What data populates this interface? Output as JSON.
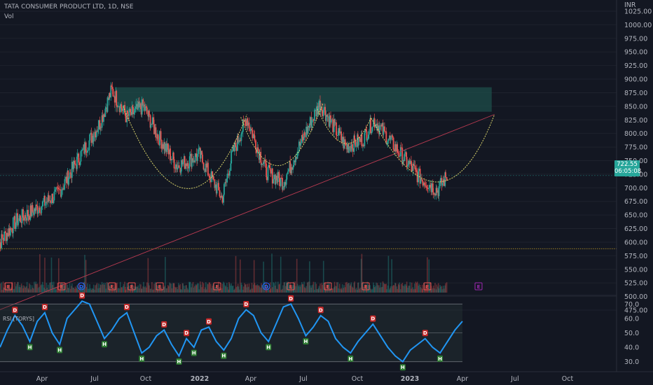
{
  "header": {
    "title": "TATA CONSUMER PRODUCT LTD, 1D, NSE",
    "volume_label": "Vol"
  },
  "price_axis": {
    "currency": "INR",
    "ticks": [
      "1025.00",
      "1000.00",
      "975.00",
      "950.00",
      "925.00",
      "900.00",
      "875.00",
      "850.00",
      "825.00",
      "800.00",
      "775.00",
      "750.00",
      "725.00",
      "700.00",
      "675.00",
      "650.00",
      "625.00",
      "600.00",
      "575.00",
      "550.00",
      "525.00",
      "500.00",
      "475.00"
    ]
  },
  "rsi_panel": {
    "title": "RSI [TORYS]",
    "ticks": [
      "70.0",
      "60.0",
      "50.0",
      "40.0",
      "30.0"
    ]
  },
  "last_price": {
    "value": "722.55",
    "countdown": "06:05:08"
  },
  "time_axis": {
    "labels": [
      "Apr",
      "Jul",
      "Oct",
      "2022",
      "Apr",
      "Jul",
      "Oct",
      "2023",
      "Apr",
      "Jul",
      "Oct"
    ]
  },
  "colors": {
    "background": "#131722",
    "up": "#26a69a",
    "down": "#ef5350",
    "rsi_line": "#2196f3",
    "curve": "#d8d36a",
    "trendline": "#b83a50",
    "zone": "#1d4d4a",
    "last_price_badge": "#26a69a",
    "earnings_badge": "#ef5350",
    "dividend_badge": "#2962ff",
    "event_purple": "#9c27b0"
  },
  "event_markers": [
    "E",
    "E",
    "D",
    "E",
    "E",
    "E",
    "E",
    "D",
    "E",
    "E",
    "E",
    "E",
    "E"
  ],
  "chart_data": {
    "type": "candlestick",
    "title": "TATA CONSUMER PRODUCT LTD, 1D, NSE",
    "ylabel": "INR",
    "ylim": [
      475,
      1025
    ],
    "trend_points": [
      {
        "date": "2021-01-08",
        "price": 590
      },
      {
        "date": "2021-02-15",
        "price": 640
      },
      {
        "date": "2021-03-20",
        "price": 660
      },
      {
        "date": "2021-05-01",
        "price": 690
      },
      {
        "date": "2021-06-10",
        "price": 760
      },
      {
        "date": "2021-07-15",
        "price": 820
      },
      {
        "date": "2021-08-05",
        "price": 880
      },
      {
        "date": "2021-09-01",
        "price": 830
      },
      {
        "date": "2021-10-01",
        "price": 850
      },
      {
        "date": "2021-10-25",
        "price": 800
      },
      {
        "date": "2021-12-01",
        "price": 740
      },
      {
        "date": "2022-01-10",
        "price": 760
      },
      {
        "date": "2022-02-20",
        "price": 680
      },
      {
        "date": "2022-03-10",
        "price": 760
      },
      {
        "date": "2022-04-05",
        "price": 830
      },
      {
        "date": "2022-05-10",
        "price": 730
      },
      {
        "date": "2022-06-10",
        "price": 710
      },
      {
        "date": "2022-07-15",
        "price": 790
      },
      {
        "date": "2022-08-15",
        "price": 855
      },
      {
        "date": "2022-10-01",
        "price": 775
      },
      {
        "date": "2022-11-01",
        "price": 790
      },
      {
        "date": "2022-11-20",
        "price": 825
      },
      {
        "date": "2023-01-01",
        "price": 770
      },
      {
        "date": "2023-02-10",
        "price": 720
      },
      {
        "date": "2023-03-15",
        "price": 695
      },
      {
        "date": "2023-04-01",
        "price": 722.55
      }
    ],
    "resistance_zone": [
      840,
      885
    ],
    "support_level": 588,
    "last_close": 722.55,
    "rsi": {
      "ylim": [
        25,
        75
      ],
      "levels": [
        70,
        50,
        30
      ],
      "values": [
        40,
        52,
        62,
        55,
        44,
        58,
        64,
        50,
        42,
        60,
        66,
        72,
        70,
        58,
        46,
        52,
        60,
        64,
        50,
        36,
        40,
        48,
        52,
        42,
        34,
        46,
        40,
        52,
        54,
        44,
        38,
        46,
        60,
        66,
        62,
        50,
        44,
        56,
        68,
        70,
        60,
        48,
        54,
        62,
        58,
        46,
        40,
        36,
        44,
        50,
        56,
        48,
        40,
        34,
        30,
        38,
        42,
        46,
        40,
        36,
        44,
        52,
        58
      ]
    },
    "time_axis": [
      "Apr",
      "Jul",
      "Oct",
      "2022",
      "Apr",
      "Jul",
      "Oct",
      "2023",
      "Apr",
      "Jul",
      "Oct"
    ]
  }
}
